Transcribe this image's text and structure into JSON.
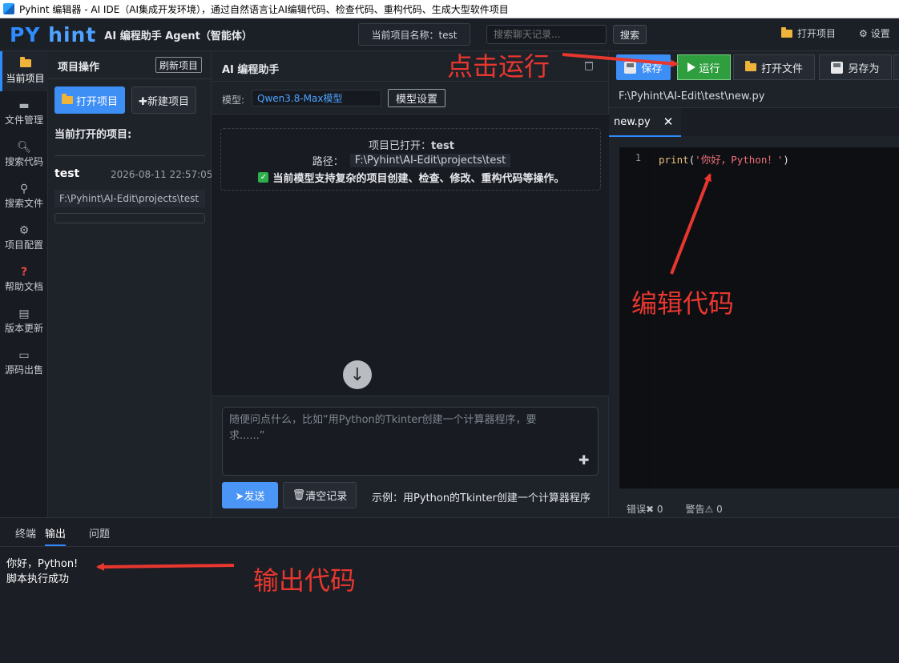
{
  "window": {
    "title": "Pyhint 编辑器 - AI IDE（AI集成开发环境），通过自然语言让AI编辑代码、检查代码、重构代码、生成大型软件项目"
  },
  "header": {
    "brand_py": "PY",
    "brand_hint": "hint",
    "subtitle": "AI 编程助手 Agent（智能体）",
    "current_project": "当前项目名称：test",
    "chat_search_placeholder": "搜索聊天记录...",
    "search_label": "搜索",
    "open_project_label": "打开项目",
    "settings_label": "设置"
  },
  "sidebar": {
    "items": [
      {
        "label": "当前项目",
        "icon": "folder-icon"
      },
      {
        "label": "文件管理",
        "icon": "drive-icon"
      },
      {
        "label": "搜索代码",
        "icon": "magnifier-icon"
      },
      {
        "label": "搜索文件",
        "icon": "magnifier-file-icon"
      },
      {
        "label": "项目配置",
        "icon": "gear-icon"
      },
      {
        "label": "帮助文档",
        "icon": "question-icon"
      },
      {
        "label": "版本更新",
        "icon": "document-icon"
      },
      {
        "label": "源码出售",
        "icon": "laptop-icon"
      }
    ]
  },
  "project_panel": {
    "title": "项目操作",
    "refresh_label": "刷新项目",
    "open_label": "打开项目",
    "new_label": "✚新建项目",
    "current_label": "当前打开的项目:",
    "project_name": "test",
    "project_date": "2026-08-11 22:57:05",
    "project_path": "F:\\Pyhint\\AI-Edit\\projects\\test"
  },
  "ai_panel": {
    "title": "AI 编程助手",
    "model_label": "模型:",
    "model_value": "Qwen3.8-Max模型",
    "model_settings_label": "模型设置",
    "info_opened_label": "项目已打开：",
    "info_opened_name": "test",
    "info_path_label": "路径：",
    "info_path_value": "F:\\Pyhint\\AI-Edit\\projects\\test",
    "info_support": "当前模型支持复杂的项目创建、检查、修改、重构代码等操作。",
    "input_placeholder": "随便问点什么，比如“用Python的Tkinter创建一个计算器程序，要求......”",
    "send_label": "➤发送",
    "clear_label": "清空记录",
    "example": "示例：用Python的Tkinter创建一个计算器程序"
  },
  "editor": {
    "save_label": "保存",
    "run_label": "运行",
    "open_file_label": "打开文件",
    "save_as_label": "另存为",
    "file_path": "F:\\Pyhint\\AI-Edit\\test\\new.py",
    "tab_name": "new.py",
    "line_number": "1",
    "code_func": "print",
    "code_open": "(",
    "code_string": "'你好，Python！'",
    "code_close": ")",
    "errors_label": "错误",
    "errors_count": "0",
    "warnings_label": "警告",
    "warnings_count": "0"
  },
  "bottom_panel": {
    "tabs": [
      "终端",
      "输出",
      "问题"
    ],
    "active_tab": "输出",
    "output_lines": [
      "你好，Python!",
      "脚本执行成功"
    ]
  },
  "annotations": {
    "run": "点击运行",
    "edit": "编辑代码",
    "output": "输出代码"
  },
  "colors": {
    "accent": "#2f8cff",
    "run_green": "#2e9e3e",
    "annotation_red": "#e8372f"
  }
}
